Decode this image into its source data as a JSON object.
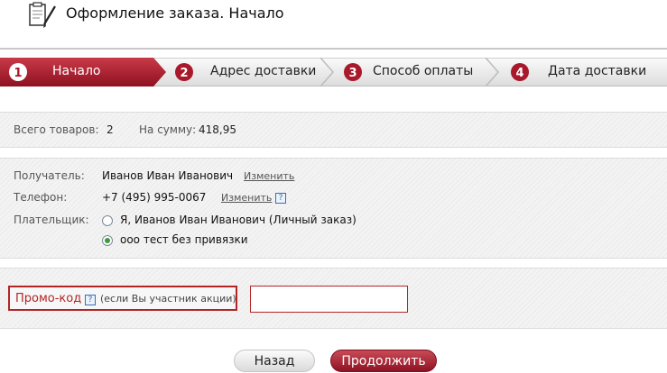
{
  "header": {
    "title": "Оформление заказа. Начало",
    "icon": "clipboard-pen-icon"
  },
  "steps": [
    {
      "num": "1",
      "label": "Начало",
      "active": true
    },
    {
      "num": "2",
      "label": "Адрес доставки",
      "active": false
    },
    {
      "num": "3",
      "label": "Способ оплаты",
      "active": false
    },
    {
      "num": "4",
      "label": "Дата доставки",
      "active": false
    }
  ],
  "summary": {
    "items_label": "Всего товаров:",
    "items_value": "2",
    "sum_label": "На сумму:",
    "sum_value": "418,95"
  },
  "recipient": {
    "label": "Получатель:",
    "name": "Иванов Иван Иванович",
    "change": "Изменить",
    "phone_label": "Телефон:",
    "phone": "+7 (495) 995-0067",
    "phone_change": "Изменить",
    "help": "?"
  },
  "payer": {
    "label": "Плательщик:",
    "options": [
      {
        "label": "Я, Иванов Иван Иванович (Личный заказ)",
        "checked": false
      },
      {
        "label": "ооо тест без привязки",
        "checked": true
      }
    ]
  },
  "promo": {
    "label": "Промо-код",
    "help": "?",
    "note": "(если Вы участник акции)",
    "value": ""
  },
  "buttons": {
    "back": "Назад",
    "next": "Продолжить"
  },
  "colors": {
    "accent": "#b32530",
    "active_step": "#a8192b",
    "radio_checked": "#3d9a3d"
  }
}
